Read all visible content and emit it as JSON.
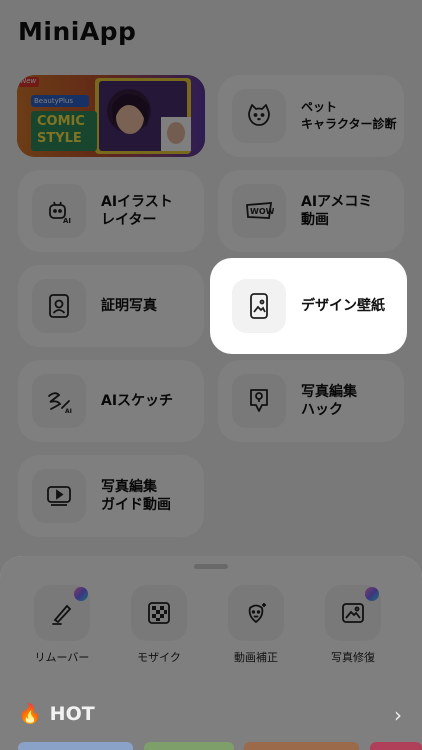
{
  "app": {
    "title": "MiniApp"
  },
  "promo": {
    "badge_new": "New",
    "brand": "BeautyPlus",
    "line1": "COMIC",
    "line2": "STYLE"
  },
  "menu": [
    {
      "key": "pet",
      "label": "ペット\nキャラクター診断",
      "icon": "cat-face-icon"
    },
    {
      "key": "ai-illust",
      "label": "AIイラスト\nレイター",
      "icon": "ai-robot-icon"
    },
    {
      "key": "ai-comic",
      "label": "AIアメコミ\n動画",
      "icon": "wow-comic-icon"
    },
    {
      "key": "id-photo",
      "label": "証明写真",
      "icon": "portrait-icon"
    },
    {
      "key": "design-wallpaper",
      "label": "デザイン壁紙",
      "icon": "phone-wallpaper-icon"
    },
    {
      "key": "ai-sketch",
      "label": "AIスケッチ",
      "icon": "sketch-pen-icon"
    },
    {
      "key": "photo-hack",
      "label": "写真編集\nハック",
      "icon": "lightbulb-icon"
    },
    {
      "key": "guide-video",
      "label": "写真編集\nガイド動画",
      "icon": "video-play-icon"
    }
  ],
  "tools": [
    {
      "label": "リムーバー",
      "icon": "eraser-brush-icon",
      "premium": true
    },
    {
      "label": "モザイク",
      "icon": "mosaic-icon",
      "premium": false
    },
    {
      "label": "動画補正",
      "icon": "face-enhance-icon",
      "premium": false
    },
    {
      "label": "写真修復",
      "icon": "photo-restore-icon",
      "premium": true
    }
  ],
  "hot": {
    "title": "HOT"
  },
  "colors": {
    "overlay": "#000000",
    "promo_purple": "#6b3fb8",
    "gem": "#7a6bff"
  }
}
